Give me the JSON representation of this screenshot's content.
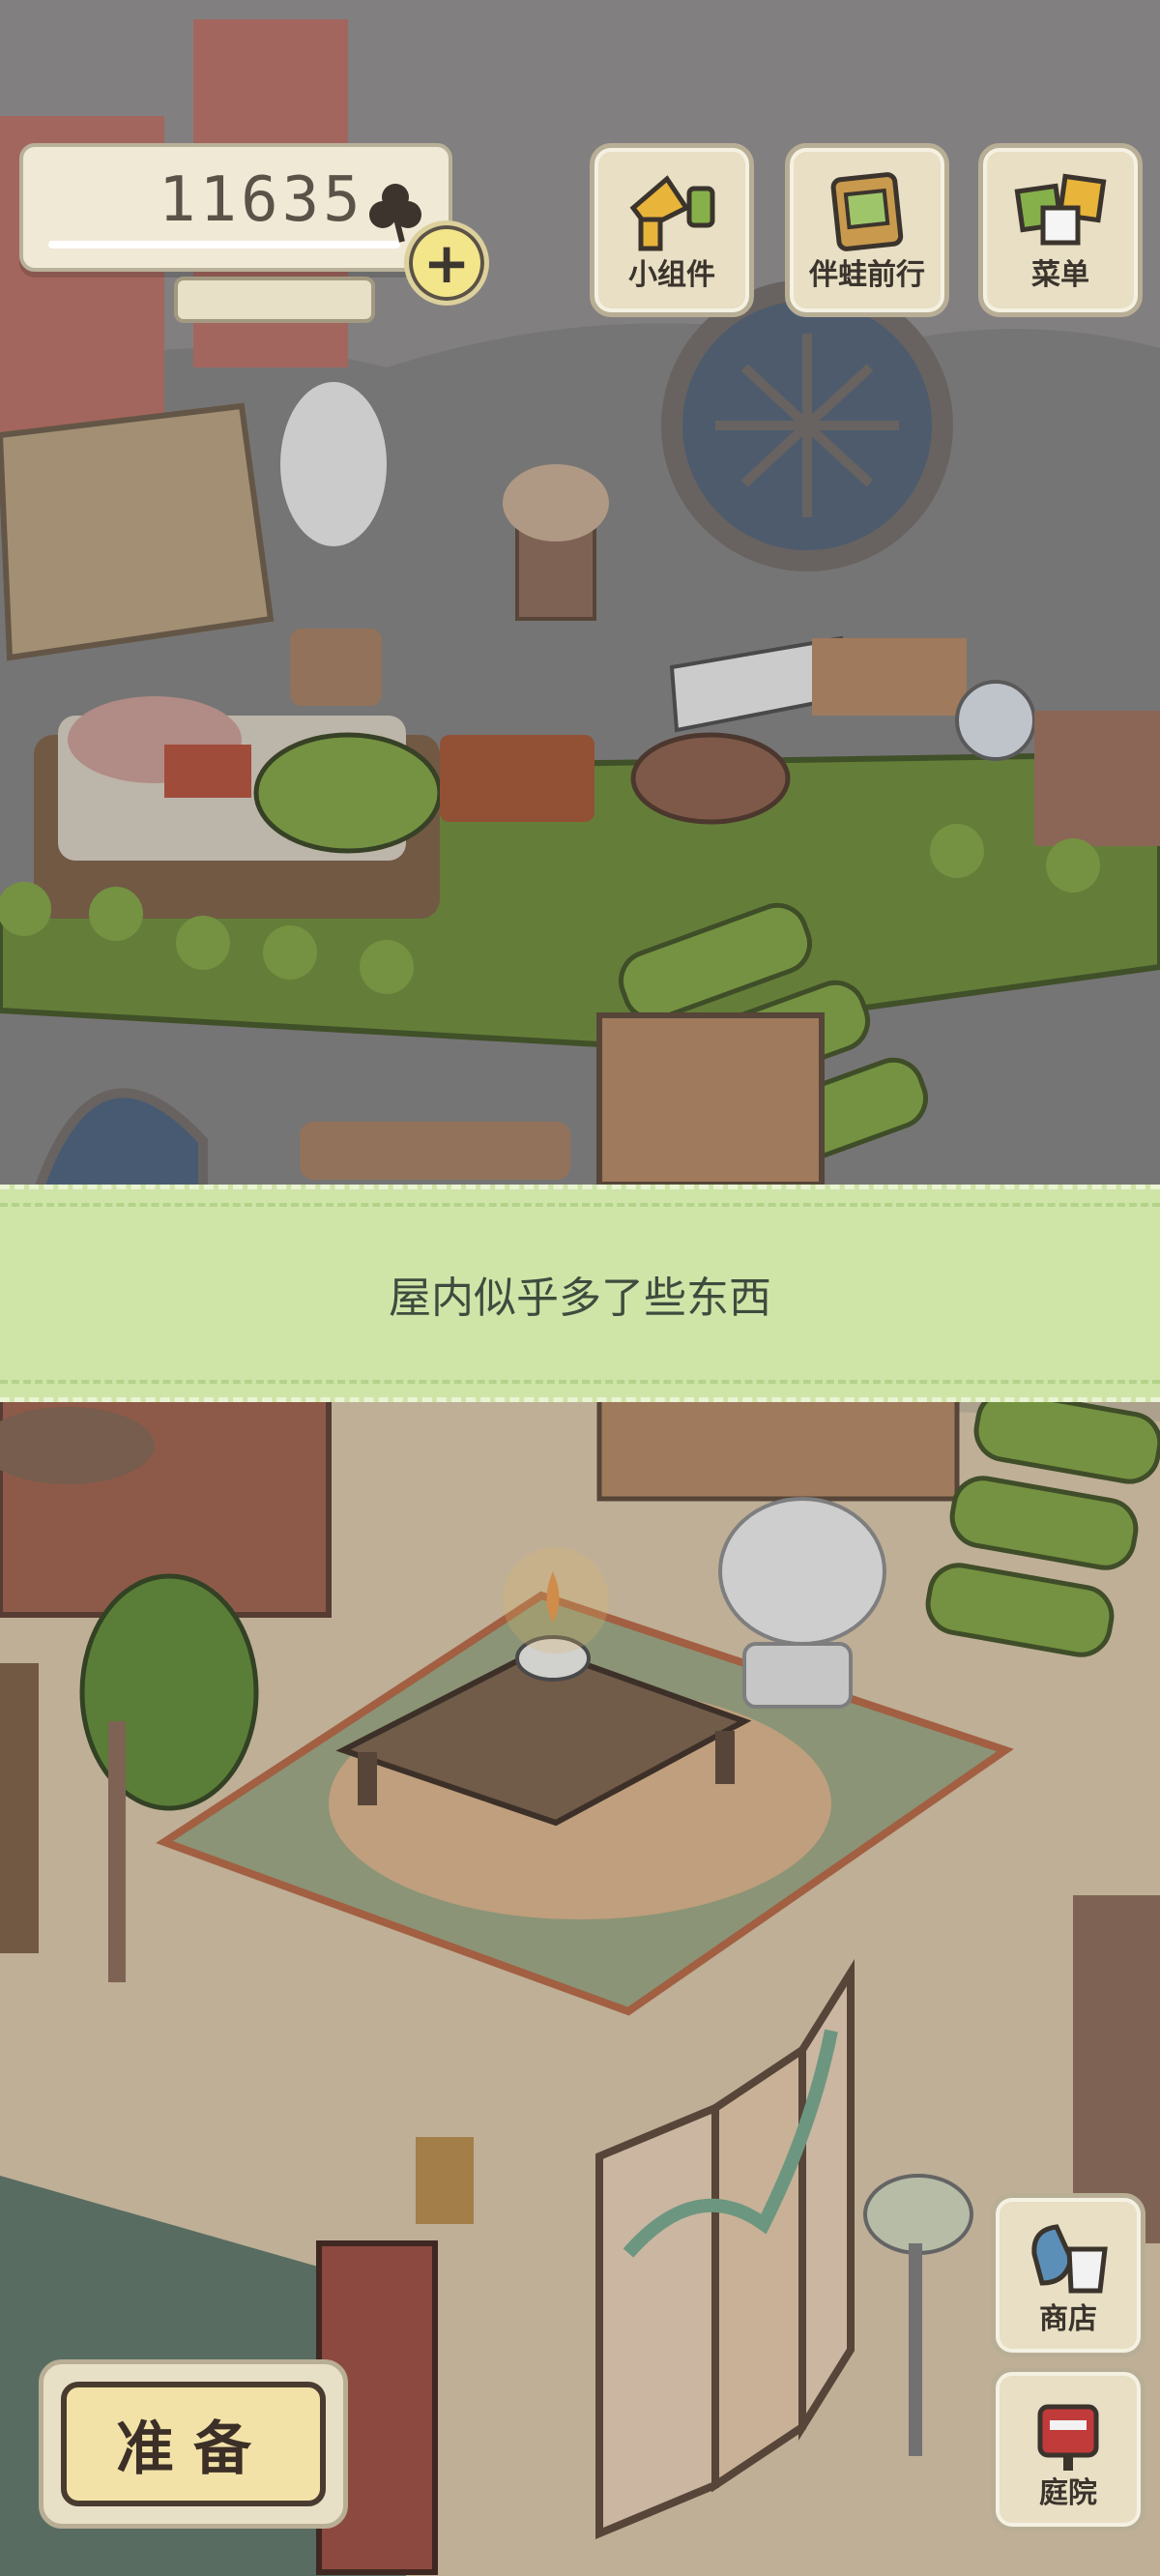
{
  "counter": {
    "value": "11635",
    "currency_icon": "clover-icon",
    "add_icon": "plus-icon"
  },
  "top_buttons": [
    {
      "name": "widgets-button",
      "label": "小组件",
      "icon": "widgets-icon"
    },
    {
      "name": "travel-with-frog-button",
      "label": "伴蛙前行",
      "icon": "journal-icon"
    },
    {
      "name": "menu-button",
      "label": "菜单",
      "icon": "menu-cards-icon"
    }
  ],
  "banner": {
    "text": "屋内似乎多了些东西"
  },
  "bottom": {
    "prepare_label": "准备",
    "shop_label": "商店",
    "yard_label": "庭院"
  },
  "colors": {
    "banner_bg": "#cfe5a8",
    "button_bg": "#e8dfc4",
    "frog_green": "#7ea33f",
    "floor": "#d8c6a6"
  }
}
